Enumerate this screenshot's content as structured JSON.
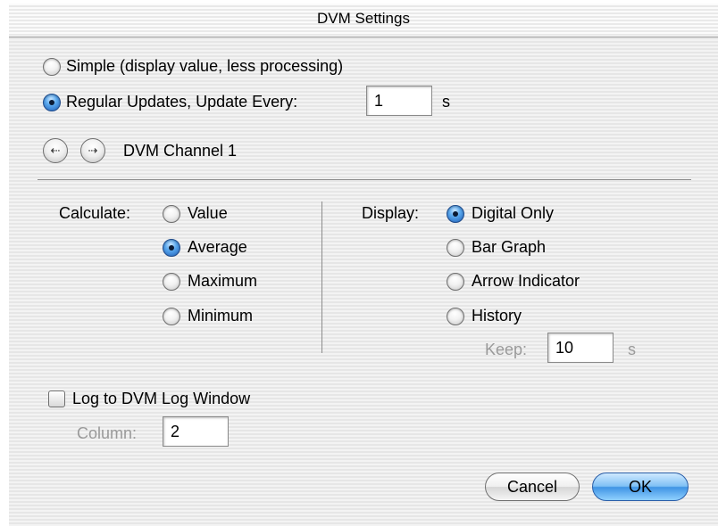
{
  "window": {
    "title": "DVM Settings"
  },
  "update_mode": {
    "simple_label": "Simple (display value, less processing)",
    "regular_label": "Regular Updates, Update Every:",
    "selected": "regular",
    "interval_value": "1",
    "interval_unit": "s"
  },
  "channel": {
    "prev_icon": "arrow-left-icon",
    "next_icon": "arrow-right-icon",
    "label": "DVM Channel 1"
  },
  "calculate": {
    "label": "Calculate:",
    "options": [
      "Value",
      "Average",
      "Maximum",
      "Minimum"
    ],
    "selected": "Average"
  },
  "display": {
    "label": "Display:",
    "options": [
      "Digital Only",
      "Bar Graph",
      "Arrow Indicator",
      "History"
    ],
    "selected": "Digital Only",
    "keep_label": "Keep:",
    "keep_value": "10",
    "keep_unit": "s"
  },
  "log": {
    "checkbox_label": "Log to DVM Log Window",
    "checked": false,
    "column_label": "Column:",
    "column_value": "2"
  },
  "buttons": {
    "cancel": "Cancel",
    "ok": "OK"
  }
}
